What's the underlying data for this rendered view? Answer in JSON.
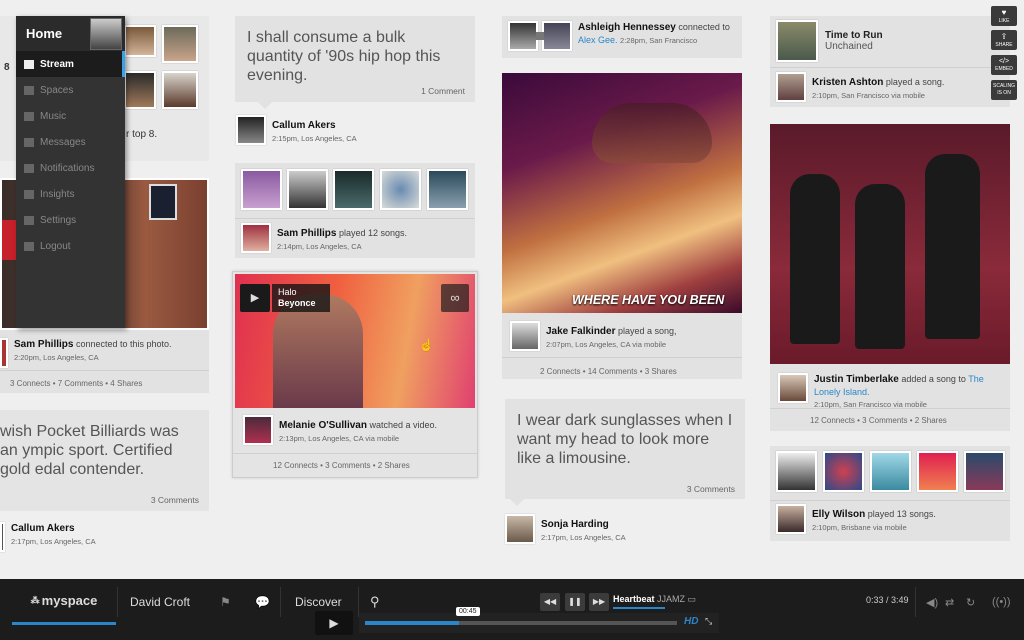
{
  "menu": {
    "home": "Home",
    "items": [
      "Stream",
      "Spaces",
      "Music",
      "Messages",
      "Notifications",
      "Insights",
      "Settings",
      "Logout"
    ]
  },
  "col0": {
    "partial_text1": "8",
    "partial_text2": "r top 8.",
    "photo_user": {
      "name": "Sam Phillips",
      "action": "connected to this photo.",
      "sub": "2:20pm, Los Angeles, CA",
      "stats": "3 Connects  •  7 Comments  •  4 Shares"
    },
    "quote": "wish Pocket Billiards was an ympic sport. Certified gold edal contender.",
    "quote_comments": "3 Comments",
    "quote_user": {
      "name": "Callum Akers",
      "sub": "2:17pm, Los Angeles, CA"
    }
  },
  "col1": {
    "quote": "I shall consume a bulk quantity of '90s hip hop this evening.",
    "quote_comments": "1 Comment",
    "quote_user": {
      "name": "Callum Akers",
      "sub": "2:15pm, Los Angeles, CA"
    },
    "songs_user": {
      "name": "Sam Phillips",
      "action": "played 12 songs.",
      "sub": "2:14pm, Los Angeles, CA"
    },
    "video": {
      "song": "Halo",
      "artist": "Beyonce"
    },
    "video_user": {
      "name": "Melanie O'Sullivan",
      "action": "watched a video.",
      "sub": "2:13pm, Los Angeles, CA via mobile",
      "stats": "12 Connects  •  3 Comments  •  2 Shares"
    }
  },
  "col2": {
    "conn_user": {
      "name": "Ashleigh Hennessey",
      "action": "connected to",
      "target": "Alex Gee.",
      "sub": "2:28pm, San Francisco"
    },
    "album_caption": "WHERE HAVE YOU BEEN",
    "album_user": {
      "name": "Jake Falkinder",
      "action": "played a song,",
      "sub": "2:07pm, Los Angeles, CA via mobile",
      "stats": "2 Connects  •  14 Comments  •  3 Shares"
    },
    "quote": "I wear dark sunglasses when I want my head to look more like a limousine.",
    "quote_comments": "3 Comments",
    "quote_user": {
      "name": "Sonja Harding",
      "sub": "2:17pm, Los Angeles, CA"
    }
  },
  "col3": {
    "song": {
      "title": "Time to Run",
      "sub": "Unchained"
    },
    "song_user": {
      "name": "Kristen Ashton",
      "action": "played a song.",
      "sub": "2:10pm, San Francisco via mobile"
    },
    "add_user": {
      "name": "Justin Timberlake",
      "action": "added a song to",
      "target": "The Lonely Island.",
      "sub": "2:10pm, San Francisco via mobile",
      "stats": "12 Connects  •  3 Comments  •  2 Shares"
    },
    "songs_user": {
      "name": "Elly Wilson",
      "action": "played 13 songs.",
      "sub": "2:10pm, Brisbane via mobile"
    }
  },
  "tools": [
    {
      "icon": "heart-icon",
      "label": "LIKE"
    },
    {
      "icon": "share-icon",
      "label": "SHARE"
    },
    {
      "icon": "embed-icon",
      "label": "EMBED"
    },
    {
      "icon": "scaling-icon",
      "label": "SCALING IS ON"
    }
  ],
  "bar": {
    "logo": "myspace",
    "user": "David Croft",
    "discover": "Discover",
    "track": "Heartbeat",
    "artist": "JJAMZ",
    "time": "0:33 / 3:49",
    "tooltip": "00:45",
    "hd": "HD",
    "progress": 0.3
  }
}
